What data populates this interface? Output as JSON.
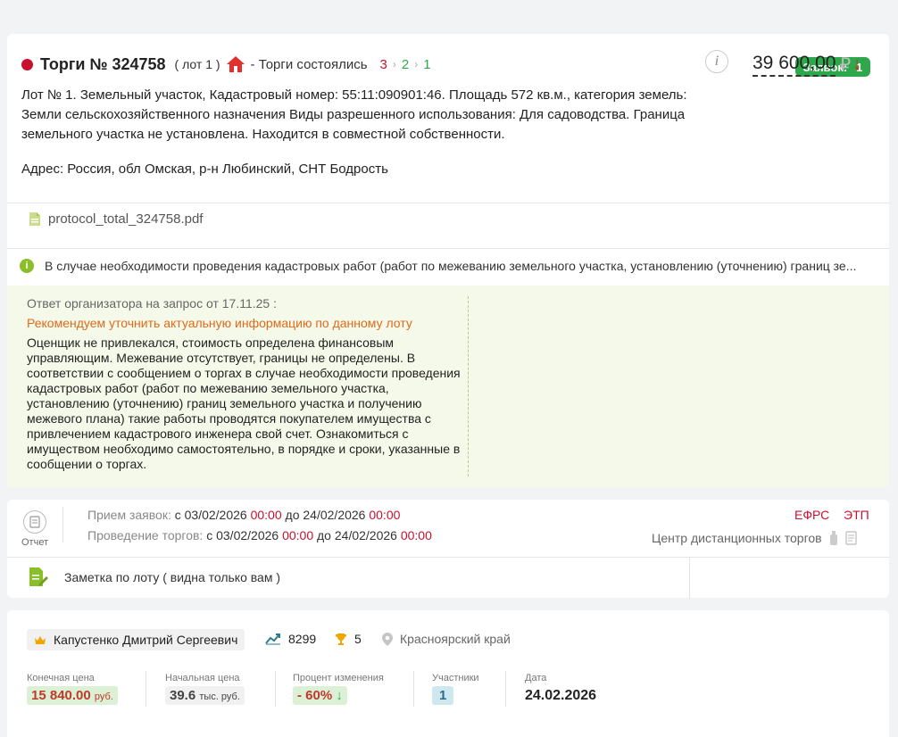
{
  "lot": {
    "title": "Торги № 324758",
    "lot_number": "( лот 1 )",
    "status": "- Торги состоялись",
    "steps": [
      "3",
      "2",
      "1"
    ],
    "bids_label": "Заявок:",
    "bids_count": "1",
    "price": "39 600,00",
    "currency": "₽",
    "price_trend": "↓",
    "description": "Лот № 1. Земельный участок, Кадастровый номер: 55:11:090901:46. Площадь 572 кв.м., категория земель: Земли сельскохозяйственного назначения Виды разрешенного использования: Для садоводства. Граница земельного участка не установлена. Находится в совместной собственности.",
    "address": "Адрес: Россия, обл Омская, р-н Любинский, СНТ Бодрость",
    "file_name": "protocol_total_324758.pdf",
    "notice": "В случае необходимости проведения кадастровых работ (работ по межеванию земельного участка, установлению (уточнению) границ зе...",
    "answer_header": "Ответ организатора на запрос от 17.11.25 :",
    "answer_warning": "Рекомендуем уточнить актуальную информацию по данному лоту",
    "answer_body": "Оценщик не привлекался, стоимость определена финансовым управляющим. Межевание отсутствует, границы не определены. В соответствии с сообщением о торгах в случае необходимости проведения кадастровых работ (работ по межеванию земельного участка, установлению (уточнению) границ земельного участка и получению межевого плана) такие работы проводятся покупателем имущества с привлечением кадастрового инженера свой счет. Ознакомиться с имуществом необходимо самостоятельно, в порядке и сроки, указанные в сообщении о торгах."
  },
  "dates": {
    "report_label": "Отчет",
    "bids_label": "Прием заявок:",
    "bids_from_prefix": "с",
    "bids_from_date": "03/02/2026",
    "bids_from_time": "00:00",
    "bids_to_prefix": "до",
    "bids_to_date": "24/02/2026",
    "bids_to_time": "00:00",
    "auction_label": "Проведение торгов:",
    "auction_from_prefix": "с",
    "auction_from_date": "03/02/2026",
    "auction_from_time": "00:00",
    "auction_to_prefix": "до",
    "auction_to_date": "24/02/2026",
    "auction_to_time": "00:00",
    "efrs": "ЕФРС",
    "etp": "ЭТП",
    "platform": "Центр дистанционных торгов",
    "note": "Заметка по лоту ( видна только вам )"
  },
  "result": {
    "winner": "Капустенко Дмитрий Сергеевич",
    "rating": "8299",
    "wins": "5",
    "region": "Красноярский край",
    "final_price_label": "Конечная цена",
    "final_price": "15 840.00",
    "final_price_unit": "руб.",
    "start_price_label": "Начальная цена",
    "start_price": "39.6",
    "start_price_unit": "тыс. руб.",
    "change_label": "Процент изменения",
    "change_value": "- 60%",
    "change_arrow": "↓",
    "participants_label": "Участники",
    "participants": "1",
    "date_label": "Дата",
    "date": "24.02.2026"
  },
  "colors": {
    "accent_red": "#c8102e",
    "accent_green": "#2ea84a",
    "warning_orange": "#e06a1a"
  }
}
